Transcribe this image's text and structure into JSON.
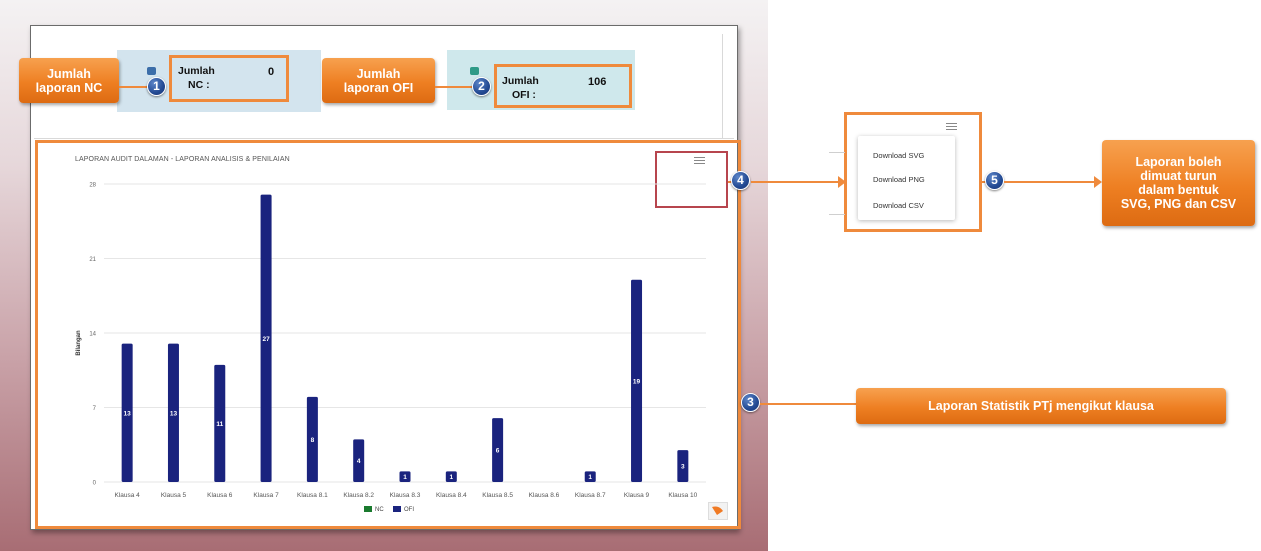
{
  "cards": {
    "nc": {
      "label_line1": "Jumlah",
      "label_line2": "NC :",
      "value": "0"
    },
    "ofi": {
      "label_line1": "Jumlah",
      "label_line2": "OFI :",
      "value": "106"
    }
  },
  "callouts": {
    "nc": {
      "line1": "Jumlah",
      "line2": "laporan NC"
    },
    "ofi": {
      "line1": "Jumlah",
      "line2": "laporan OFI"
    },
    "stat": {
      "text": "Laporan Statistik PTj mengikut klausa"
    },
    "download": {
      "line1": "Laporan boleh",
      "line2": "dimuat turun",
      "line3": "dalam bentuk",
      "line4": "SVG, PNG dan CSV"
    }
  },
  "markers": [
    "1",
    "2",
    "3",
    "4",
    "5"
  ],
  "download_menu": {
    "items": [
      "Download SVG",
      "Download PNG",
      "Download CSV"
    ]
  },
  "colors": {
    "accent_orange": "#ef8a3c",
    "marker_blue": "#234a93",
    "nc": "#1a7a2e",
    "ofi": "#1a237e"
  },
  "icons": {
    "menu": "hamburger-menu-icon"
  },
  "chart_data": {
    "type": "bar",
    "title": "LAPORAN AUDIT DALAMAN - LAPORAN ANALISIS & PENILAIAN",
    "ylabel": "Bilangan",
    "xlabel": "",
    "ylim": [
      0,
      28
    ],
    "yticks": [
      "0",
      "7",
      "14",
      "21",
      "28"
    ],
    "categories": [
      "Klausa 4",
      "Klausa 5",
      "Klausa 6",
      "Klausa 7",
      "Klausa 8.1",
      "Klausa 8.2",
      "Klausa 8.3",
      "Klausa 8.4",
      "Klausa 8.5",
      "Klausa 8.6",
      "Klausa 8.7",
      "Klausa 9",
      "Klausa 10"
    ],
    "series": [
      {
        "name": "NC",
        "values": [
          0,
          0,
          0,
          0,
          0,
          0,
          0,
          0,
          0,
          0,
          0,
          0,
          0
        ]
      },
      {
        "name": "OFI",
        "values": [
          13,
          13,
          11,
          27,
          8,
          4,
          1,
          1,
          6,
          0,
          1,
          19,
          3
        ]
      }
    ],
    "legend": [
      "NC",
      "OFI"
    ],
    "legend_position": "bottom",
    "grid": true
  }
}
